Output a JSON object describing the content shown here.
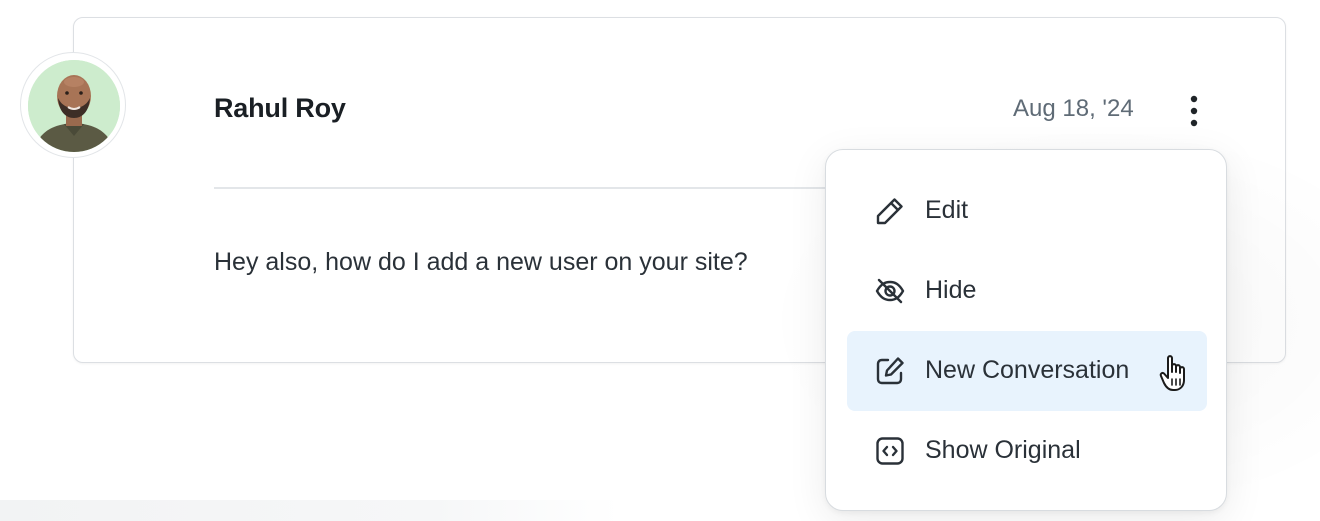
{
  "comment": {
    "author": "Rahul Roy",
    "date": "Aug 18, '24",
    "message": "Hey also, how do I add a new user on your site?"
  },
  "icons": {
    "more": "vertical-ellipsis-icon",
    "edit": "pencil-icon",
    "hide": "eye-off-icon",
    "new_conversation": "edit-square-icon",
    "show_original": "code-icon",
    "cursor": "hand-pointer-icon"
  },
  "menu": {
    "items": [
      {
        "label": "Edit",
        "icon": "pencil-icon",
        "active": false
      },
      {
        "label": "Hide",
        "icon": "eye-off-icon",
        "active": false
      },
      {
        "label": "New Conversation",
        "icon": "edit-square-icon",
        "active": true
      },
      {
        "label": "Show Original",
        "icon": "code-icon",
        "active": false
      }
    ]
  },
  "colors": {
    "highlight": "#e8f3fd",
    "avatar_bg": "#cfeccf",
    "text": "#2a3138",
    "muted": "#5f6b76"
  }
}
